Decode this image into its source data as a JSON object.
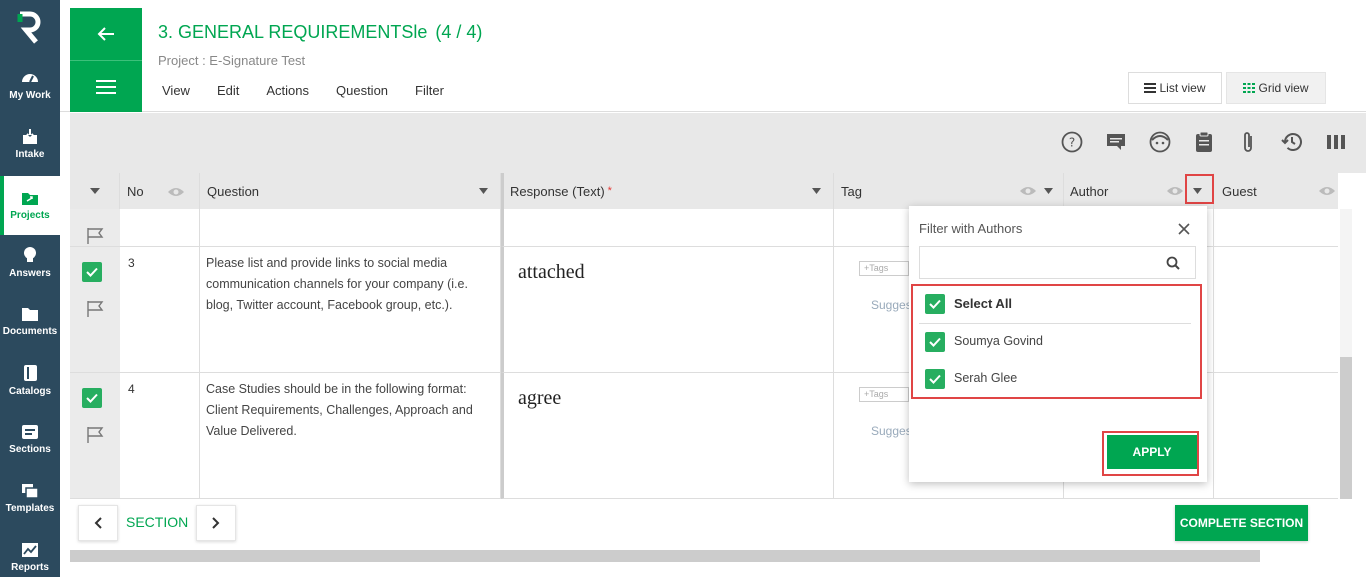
{
  "sidebar": {
    "items": [
      {
        "label": "My Work",
        "icon": "speedometer-icon"
      },
      {
        "label": "Intake",
        "icon": "inbox-download-icon"
      },
      {
        "label": "Projects",
        "icon": "folder-share-icon"
      },
      {
        "label": "Answers",
        "icon": "lightbulb-icon"
      },
      {
        "label": "Documents",
        "icon": "folder-icon"
      },
      {
        "label": "Catalogs",
        "icon": "book-icon"
      },
      {
        "label": "Sections",
        "icon": "sections-icon"
      },
      {
        "label": "Templates",
        "icon": "templates-icon"
      },
      {
        "label": "Reports",
        "icon": "chart-icon"
      }
    ]
  },
  "header": {
    "title": "3. GENERAL REQUIREMENTSle",
    "count": "(4 / 4)",
    "project": "Project : E-Signature Test",
    "menu": [
      "View",
      "Edit",
      "Actions",
      "Question",
      "Filter"
    ],
    "list_view": "List view",
    "grid_view": "Grid view"
  },
  "columns": {
    "no": "No",
    "question": "Question",
    "response": "Response (Text)",
    "required_mark": "*",
    "tag": "Tag",
    "author": "Author",
    "guest": "Guest"
  },
  "rows": [
    {
      "no": "3",
      "question": "Please list and provide links to social media communication channels for your company (i.e. blog, Twitter account, Facebook group, etc.).",
      "response": "attached",
      "tag_placeholder": "+Tags",
      "suggest": "Sugges"
    },
    {
      "no": "4",
      "question": "Case Studies should be in the following format: Client Requirements, Challenges, Approach and Value Delivered.",
      "response": "agree",
      "tag_placeholder": "+Tags",
      "suggest": "Sugges"
    }
  ],
  "filter_popup": {
    "title": "Filter with Authors",
    "search_placeholder": "",
    "select_all": "Select All",
    "authors": [
      "Soumya Govind",
      "Serah Glee"
    ],
    "apply": "APPLY"
  },
  "footer": {
    "section": "SECTION",
    "complete": "COMPLETE SECTION"
  },
  "colors": {
    "brand_green": "#00a651",
    "sidebar": "#2c4a5e",
    "highlight_red": "#e04545"
  }
}
